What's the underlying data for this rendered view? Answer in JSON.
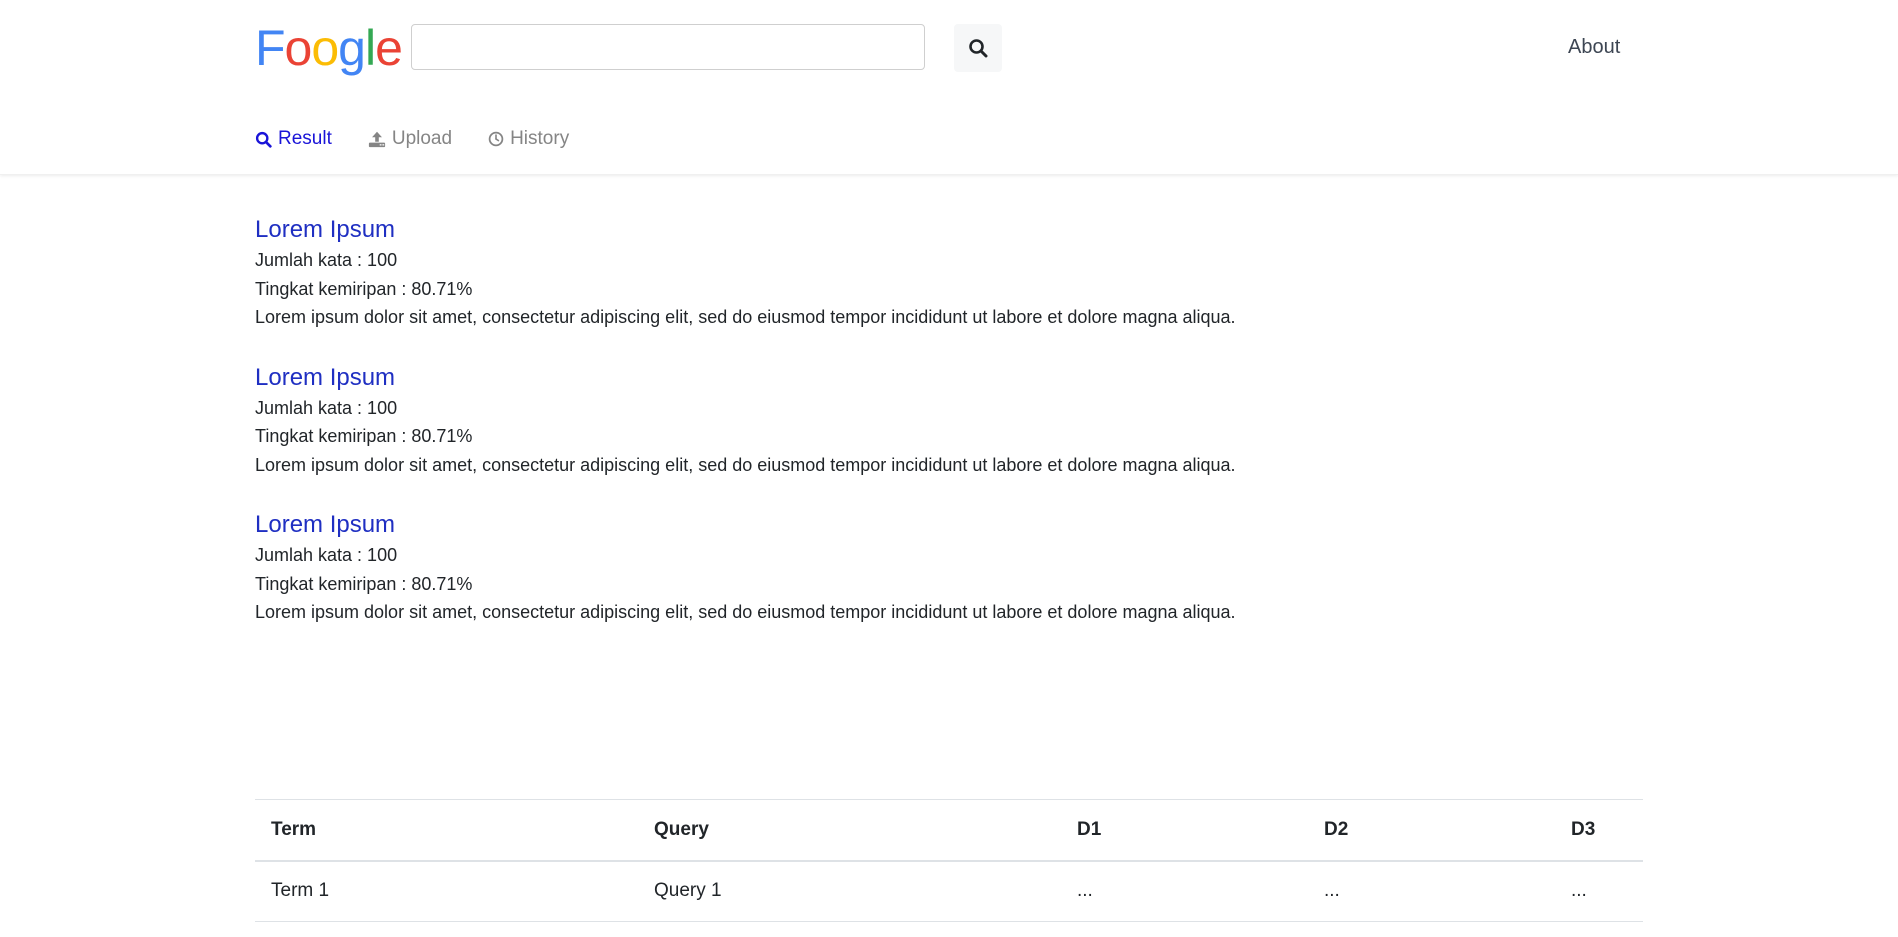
{
  "header": {
    "logo_letters": [
      "F",
      "o",
      "o",
      "g",
      "l",
      "e"
    ],
    "logo_colors": [
      "#4285f4",
      "#ea4335",
      "#fbbc05",
      "#4285f4",
      "#34a853",
      "#ea4335"
    ],
    "search_value": "",
    "search_placeholder": "",
    "search_icon": "search-icon",
    "about_label": "About"
  },
  "nav": {
    "items": [
      {
        "label": "Result",
        "icon": "search-icon",
        "active": true
      },
      {
        "label": "Upload",
        "icon": "upload-icon",
        "active": false
      },
      {
        "label": "History",
        "icon": "clock-icon",
        "active": false
      }
    ],
    "active_color": "#1a14d8",
    "inactive_color": "#858585"
  },
  "results": [
    {
      "title": "Lorem Ipsum",
      "word_count": "Jumlah kata : 100",
      "similarity": "Tingkat kemiripan : 80.71%",
      "description": "Lorem ipsum dolor sit amet, consectetur adipiscing elit, sed do eiusmod tempor incididunt ut labore et dolore magna aliqua."
    },
    {
      "title": "Lorem Ipsum",
      "word_count": "Jumlah kata : 100",
      "similarity": "Tingkat kemiripan : 80.71%",
      "description": "Lorem ipsum dolor sit amet, consectetur adipiscing elit, sed do eiusmod tempor incididunt ut labore et dolore magna aliqua."
    },
    {
      "title": "Lorem Ipsum",
      "word_count": "Jumlah kata : 100",
      "similarity": "Tingkat kemiripan : 80.71%",
      "description": "Lorem ipsum dolor sit amet, consectetur adipiscing elit, sed do eiusmod tempor incididunt ut labore et dolore magna aliqua."
    }
  ],
  "table": {
    "headers": [
      "Term",
      "Query",
      "D1",
      "D2",
      "D3"
    ],
    "rows": [
      [
        "Term 1",
        "Query 1",
        "...",
        "...",
        "..."
      ]
    ]
  }
}
